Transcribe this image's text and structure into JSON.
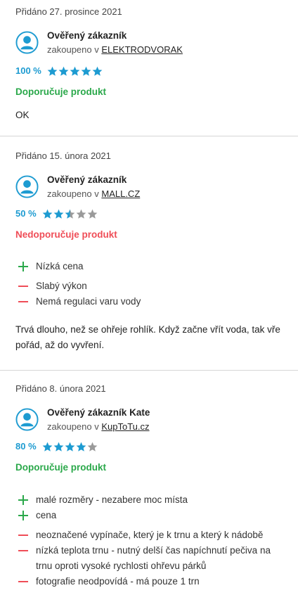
{
  "colors": {
    "percent": "#1d9bd1",
    "star_filled": "#1d9bd1",
    "star_empty": "#9a9a9a",
    "recommend": "#2aa84a",
    "not_recommend": "#ef4d57",
    "pro_sign": "#2aa84a",
    "con_sign": "#ef4d57",
    "divider": "#d6d6d6"
  },
  "reviews": [
    {
      "date": "Přidáno 27. prosince 2021",
      "user": "Ověřený zákazník",
      "bought_prefix": "zakoupeno v",
      "shop": "ELEKTRODVORAK",
      "percent": "100 %",
      "stars": 5,
      "verdict": "Doporučuje produkt",
      "recommend": true,
      "pros": [],
      "cons": [],
      "text": "OK"
    },
    {
      "date": "Přidáno 15. února 2021",
      "user": "Ověřený zákazník",
      "bought_prefix": "zakoupeno v",
      "shop": "MALL.CZ",
      "percent": "50 %",
      "stars": 2.5,
      "verdict": "Nedoporučuje produkt",
      "recommend": false,
      "pros": [
        "Nízká cena"
      ],
      "cons": [
        "Slabý výkon",
        "Nemá regulaci varu vody"
      ],
      "text": "Trvá dlouho, než se ohřeje rohlík. Když začne vřít voda, tak vře pořád, až do vyvření."
    },
    {
      "date": "Přidáno 8. února 2021",
      "user": "Ověřený zákazník Kate",
      "bought_prefix": "zakoupeno v",
      "shop": "KupToTu.cz",
      "percent": "80 %",
      "stars": 4,
      "verdict": "Doporučuje produkt",
      "recommend": true,
      "pros": [
        "malé rozměry - nezabere moc místa",
        "cena"
      ],
      "cons": [
        "neoznačené vypínače, který je k trnu a který k nádobě",
        "nízká teplota trnu - nutný delší čas napíchnutí pečiva na trnu oproti vysoké rychlosti ohřevu párků",
        "fotografie neodpovídá - má pouze 1 trn"
      ],
      "text": ""
    }
  ]
}
